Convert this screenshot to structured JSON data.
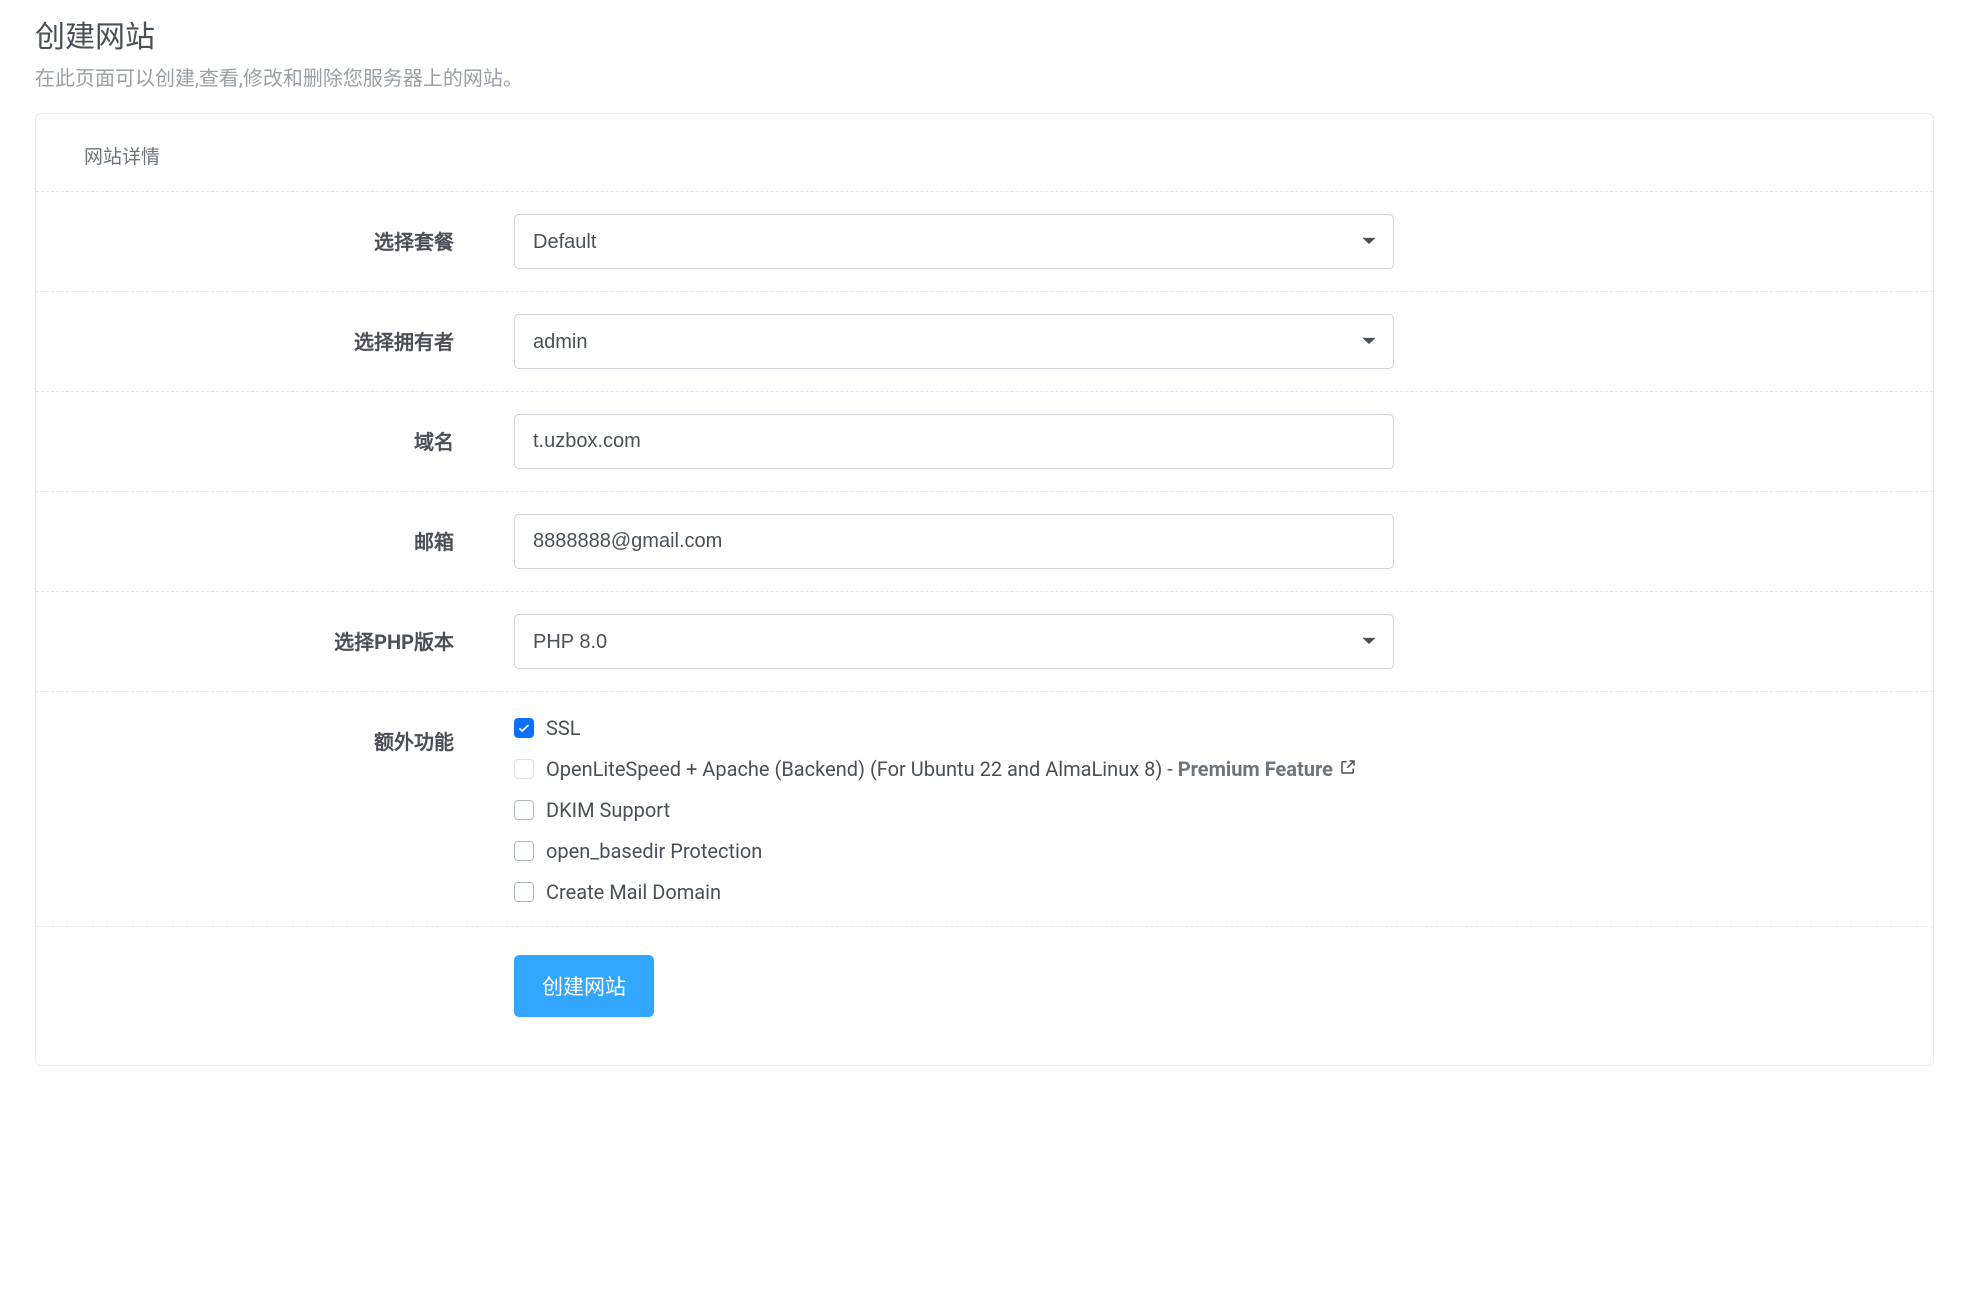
{
  "header": {
    "title": "创建网站",
    "subtitle": "在此页面可以创建,查看,修改和删除您服务器上的网站。"
  },
  "section": {
    "title": "网站详情"
  },
  "labels": {
    "package": "选择套餐",
    "owner": "选择拥有者",
    "domain": "域名",
    "email": "邮箱",
    "php": "选择PHP版本",
    "extra": "额外功能"
  },
  "values": {
    "package": "Default",
    "owner": "admin",
    "domain": "t.uzbox.com",
    "email": "8888888@gmail.com",
    "php": "PHP 8.0"
  },
  "checks": {
    "ssl": "SSL",
    "ols_apache_prefix": "OpenLiteSpeed + Apache (Backend) (For Ubuntu 22 and AlmaLinux 8) - ",
    "premium_label": "Premium Feature",
    "dkim": "DKIM Support",
    "open_basedir": "open_basedir Protection",
    "mail_domain": "Create Mail Domain"
  },
  "actions": {
    "create": "创建网站"
  }
}
